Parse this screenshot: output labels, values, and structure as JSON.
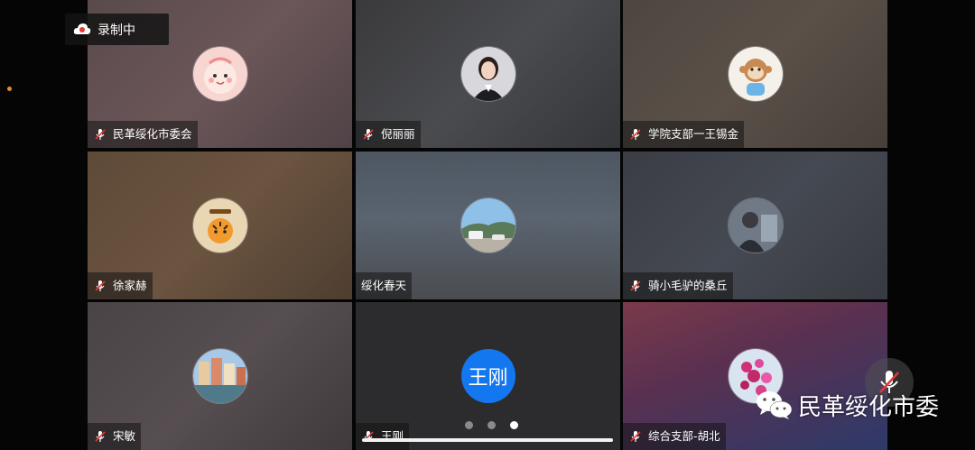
{
  "recording": {
    "label": "录制中",
    "icon": "cloud-record-icon"
  },
  "participants": [
    {
      "name": "民革绥化市委会",
      "muted": true,
      "avatar": "cartoon-pink-avatar"
    },
    {
      "name": "倪丽丽",
      "muted": true,
      "avatar": "woman-portrait-avatar"
    },
    {
      "name": "学院支部一王锡金",
      "muted": true,
      "avatar": "monkey-toy-avatar"
    },
    {
      "name": "徐家赫",
      "muted": true,
      "avatar": "tiger-cartoon-avatar"
    },
    {
      "name": "绥化春天",
      "muted": false,
      "avatar": "landscape-car-avatar"
    },
    {
      "name": "骑小毛驴的桑丘",
      "muted": true,
      "avatar": "person-photo-avatar"
    },
    {
      "name": "宋敏",
      "muted": true,
      "avatar": "town-canal-avatar"
    },
    {
      "name": "王刚",
      "muted": true,
      "avatar_text": "王刚"
    },
    {
      "name": "综合支部-胡北",
      "muted": true,
      "avatar": "flowers-avatar"
    }
  ],
  "pager": {
    "pages": 3,
    "current": 3
  },
  "watermark": {
    "text": "民革绥化市委",
    "icon": "wechat-icon"
  },
  "mic_button": {
    "icon": "microphone-muted-icon"
  },
  "colors": {
    "accent": "#1377f0",
    "mute_red": "#e53935"
  }
}
